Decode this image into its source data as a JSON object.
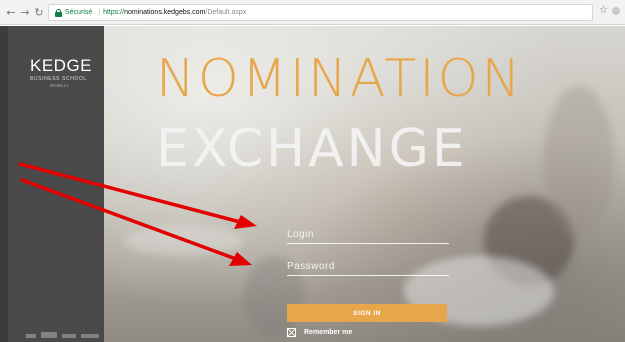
{
  "browser": {
    "secure_label": "Sécurisé",
    "url_scheme": "https://",
    "url_host": "nominations.kedgebs.com",
    "url_path": "/Default.aspx"
  },
  "sidebar": {
    "logo_main": "KEDGE",
    "logo_sub": "BUSINESS SCHOOL",
    "logo_year": "RETIRE 2.1"
  },
  "hero": {
    "title_line1": "NOMINATION",
    "title_line2": "EXCHANGE"
  },
  "form": {
    "login_placeholder": "Login",
    "password_placeholder": "Password",
    "signin_label": "SIGN IN",
    "remember_label": "Remember me"
  },
  "colors": {
    "accent": "#e8a64b",
    "sidebar": "#4a4a4a",
    "annotation": "#e30000"
  }
}
